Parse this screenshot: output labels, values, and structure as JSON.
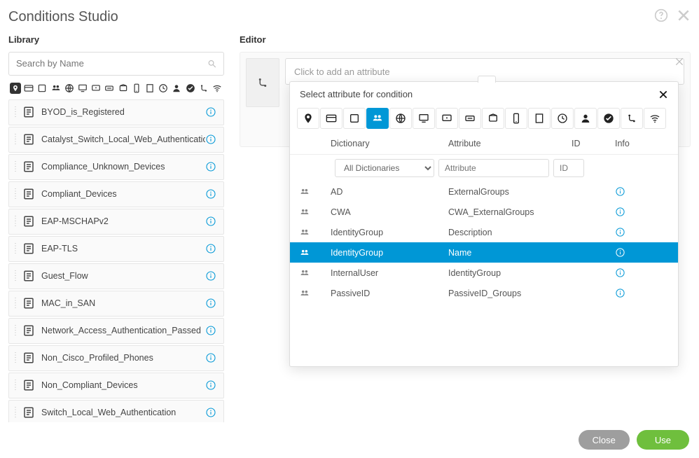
{
  "header": {
    "title": "Conditions Studio"
  },
  "library": {
    "title": "Library",
    "search_placeholder": "Search by Name",
    "items": [
      {
        "label": "BYOD_is_Registered"
      },
      {
        "label": "Catalyst_Switch_Local_Web_Authentication"
      },
      {
        "label": "Compliance_Unknown_Devices"
      },
      {
        "label": "Compliant_Devices"
      },
      {
        "label": "EAP-MSCHAPv2"
      },
      {
        "label": "EAP-TLS"
      },
      {
        "label": "Guest_Flow"
      },
      {
        "label": "MAC_in_SAN"
      },
      {
        "label": "Network_Access_Authentication_Passed"
      },
      {
        "label": "Non_Cisco_Profiled_Phones"
      },
      {
        "label": "Non_Compliant_Devices"
      },
      {
        "label": "Switch_Local_Web_Authentication"
      }
    ]
  },
  "editor": {
    "title": "Editor",
    "placeholder": "Click to add an attribute"
  },
  "popover": {
    "title": "Select attribute for condition",
    "columns": {
      "dict": "Dictionary",
      "attr": "Attribute",
      "id": "ID",
      "info": "Info"
    },
    "filters": {
      "dict_selected": "All Dictionaries",
      "attr_placeholder": "Attribute",
      "id_placeholder": "ID"
    },
    "rows": [
      {
        "dict": "AD",
        "attr": "ExternalGroups",
        "selected": false
      },
      {
        "dict": "CWA",
        "attr": "CWA_ExternalGroups",
        "selected": false
      },
      {
        "dict": "IdentityGroup",
        "attr": "Description",
        "selected": false
      },
      {
        "dict": "IdentityGroup",
        "attr": "Name",
        "selected": true
      },
      {
        "dict": "InternalUser",
        "attr": "IdentityGroup",
        "selected": false
      },
      {
        "dict": "PassiveID",
        "attr": "PassiveID_Groups",
        "selected": false
      }
    ]
  },
  "footer": {
    "close": "Close",
    "use": "Use"
  },
  "colors": {
    "accent": "#0097d6",
    "green": "#6fbf3d"
  }
}
